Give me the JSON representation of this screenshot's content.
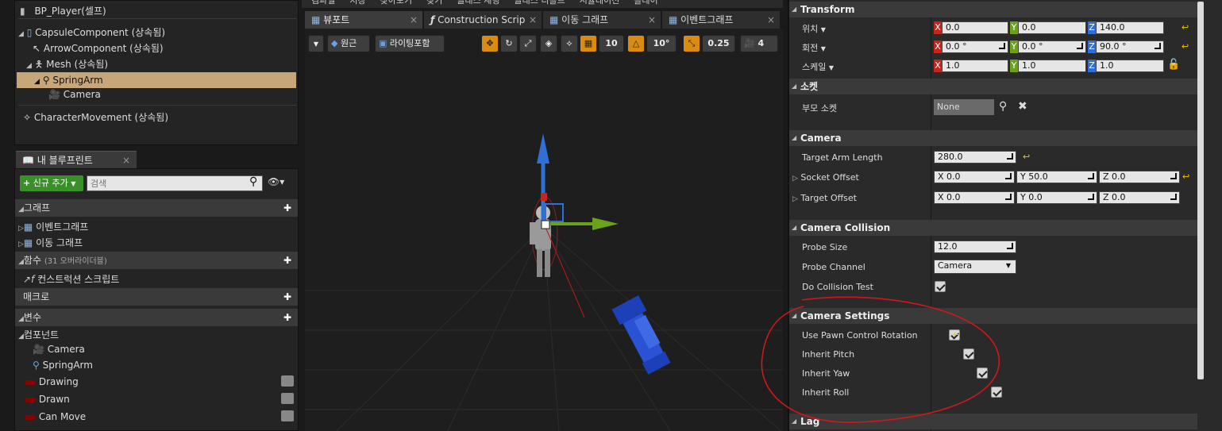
{
  "components_tree": {
    "root": "BP_Player(셀프)",
    "items": [
      {
        "label": "CapsuleComponent (상속됨)"
      },
      {
        "label": "ArrowComponent (상속됨)"
      },
      {
        "label": "Mesh (상속됨)"
      },
      {
        "label": "SpringArm"
      },
      {
        "label": "Camera"
      },
      {
        "label": "CharacterMovement (상속됨)"
      }
    ]
  },
  "my_blueprint": {
    "tab_label": "내 블루프린트",
    "add_new": "신규 추가",
    "search_placeholder": "검색",
    "graphs_header": "그래프",
    "graphs": [
      "이벤트그래프",
      "이동 그래프"
    ],
    "functions_header": "함수",
    "functions_count": "(31 오버라이더블)",
    "construction_script": "컨스트럭션 스크립트",
    "macros_header": "매크로",
    "variables_header": "변수",
    "components_header": "컴포넌트",
    "components": [
      "Camera",
      "SpringArm"
    ],
    "variables": [
      "Drawing",
      "Drawn",
      "Can Move"
    ]
  },
  "top_menu": {
    "items": [
      "컴파일",
      "저장",
      "찾아보기",
      "찾기",
      "클래스 세팅",
      "클래스 디폴트",
      "시뮬레이션",
      "플레이"
    ]
  },
  "editor_tabs": [
    "뷰포트",
    "Construction Scrip",
    "이동 그래프",
    "이벤트그래프"
  ],
  "viewport_toolbar": {
    "perspective": "원근",
    "lighting": "라이팅포함",
    "grid_snap": "10",
    "rot_snap": "10°",
    "scale_snap": "0.25",
    "camera_speed": "4"
  },
  "details": {
    "transform": {
      "header": "Transform",
      "location_label": "위치",
      "rotation_label": "회전",
      "scale_label": "스케일",
      "location": [
        "0.0",
        "0.0",
        "140.0"
      ],
      "rotation": [
        "0.0 °",
        "0.0 °",
        "90.0 °"
      ],
      "scale": [
        "1.0",
        "1.0",
        "1.0"
      ]
    },
    "socket": {
      "header": "소켓",
      "parent_socket_label": "부모 소켓",
      "parent_socket_value": "None"
    },
    "camera": {
      "header": "Camera",
      "target_arm_length_label": "Target Arm Length",
      "target_arm_length": "280.0",
      "socket_offset_label": "Socket Offset",
      "socket_offset": [
        "X 0.0",
        "Y 50.0",
        "Z 0.0"
      ],
      "target_offset_label": "Target Offset",
      "target_offset": [
        "X 0.0",
        "Y 0.0",
        "Z 0.0"
      ]
    },
    "camera_collision": {
      "header": "Camera Collision",
      "probe_size_label": "Probe Size",
      "probe_size": "12.0",
      "probe_channel_label": "Probe Channel",
      "probe_channel": "Camera",
      "do_collision_test_label": "Do Collision Test"
    },
    "camera_settings": {
      "header": "Camera Settings",
      "rows": [
        "Use Pawn Control Rotation",
        "Inherit Pitch",
        "Inherit Yaw",
        "Inherit Roll"
      ]
    },
    "lag": {
      "header": "Lag"
    }
  },
  "colors": {
    "x_axis": "#c8241c",
    "y_axis": "#6aa31a",
    "z_axis": "#2f6fd6",
    "annotation": "#d01818",
    "selection": "#c7a77a"
  }
}
